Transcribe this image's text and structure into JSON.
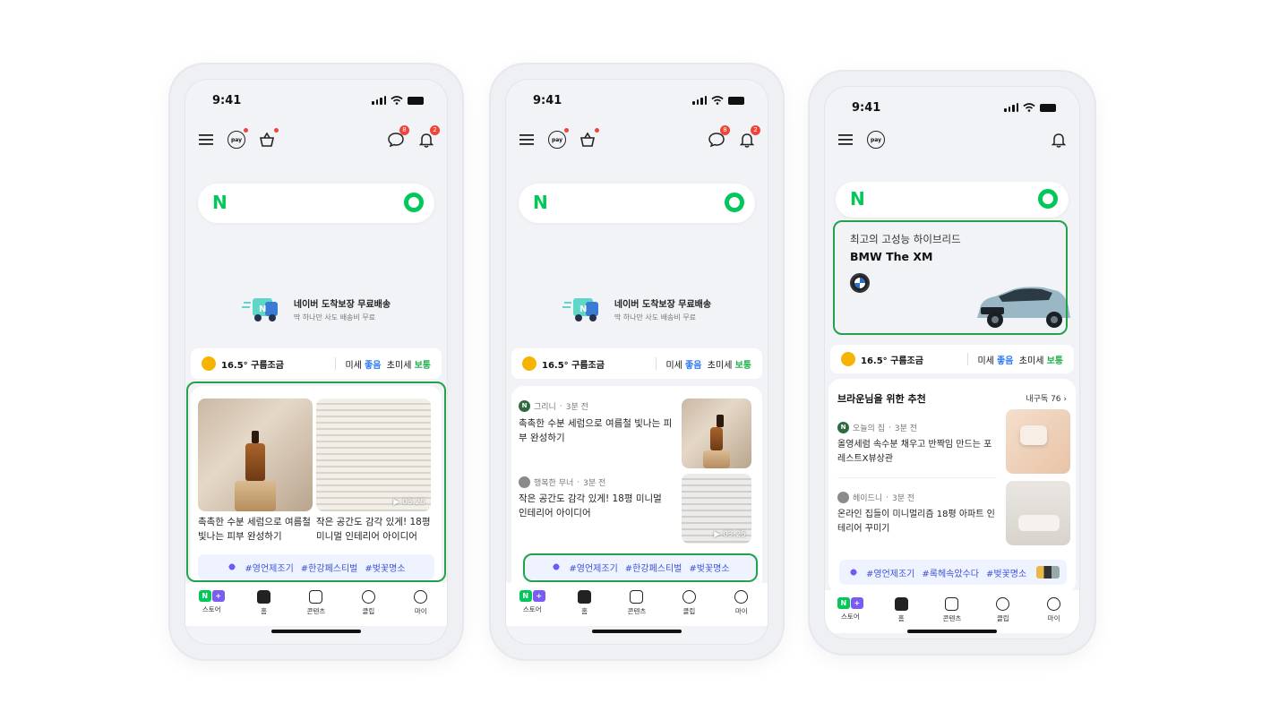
{
  "status": {
    "time": "9:41"
  },
  "icons": {
    "menu": "menu-icon",
    "pay": "pay-icon",
    "cart": "basket-icon",
    "chat": "chat-icon",
    "bell": "bell-icon"
  },
  "topbar": {
    "pay_label": "pay",
    "chat_count": "8",
    "bell_count": "2"
  },
  "search": {
    "logo": "N"
  },
  "promo": {
    "title": "네이버 도착보장 무료배송",
    "subtitle": "딱 하나만 사도 배송비 무료"
  },
  "weather": {
    "temp": "16.5° 구름조금",
    "fine_dust_label": "미세",
    "fine_dust_value": "좋음",
    "ultra_fine_label": "초미세",
    "ultra_fine_value": "보통"
  },
  "phone1": {
    "cards": [
      {
        "title": "촉촉한 수분 세럼으로 여름철 빛나는 피부 완성하기"
      },
      {
        "title": "작은 공간도 감각 있게! 18평 미니멀 인테리어 아이디어",
        "duration": "03:25"
      }
    ],
    "tags": [
      "#영언제조기",
      "#한강페스티벌",
      "#벚꽃명소"
    ]
  },
  "phone2": {
    "posts": [
      {
        "author": "그리니",
        "time": "3분 전",
        "title": "촉촉한 수분 세럼으로 여름철 빛나는 피부 완성하기"
      },
      {
        "author": "행복한 무너",
        "time": "3분 전",
        "title": "작은 공간도 감각 있게! 18평 미니멀 인테리어 아이디어",
        "duration": "03:25"
      }
    ],
    "tags": [
      "#영언제조기",
      "#한강페스티벌",
      "#벚꽃명소"
    ]
  },
  "phone3": {
    "ad": {
      "line1": "최고의 고성능 하이브리드",
      "line2": "BMW The XM"
    },
    "section_title": "브라운님을 위한 추천",
    "subscription": "내구독 76",
    "posts": [
      {
        "author": "오늘의 집",
        "time": "3분 전",
        "title": "올영세럼 속수분 채우고 반짝임 만드는 포레스트X뷰상관"
      },
      {
        "author": "헤이드니",
        "time": "3분 전",
        "title": "온라인 집들이 미니멀리즘 18평 아파트 인테리어 꾸미기"
      }
    ],
    "tags": [
      "#영언제조기",
      "#록헤속았수다",
      "#벚꽃명소"
    ]
  },
  "nav": [
    {
      "label": "스토어"
    },
    {
      "label": "홈"
    },
    {
      "label": "콘텐츠"
    },
    {
      "label": "클립"
    },
    {
      "label": "마이"
    }
  ],
  "colors": {
    "naver_green": "#03c75a",
    "frame_green": "#23a24d",
    "badge_red": "#f04438",
    "tag_blue": "#3c55d6"
  }
}
